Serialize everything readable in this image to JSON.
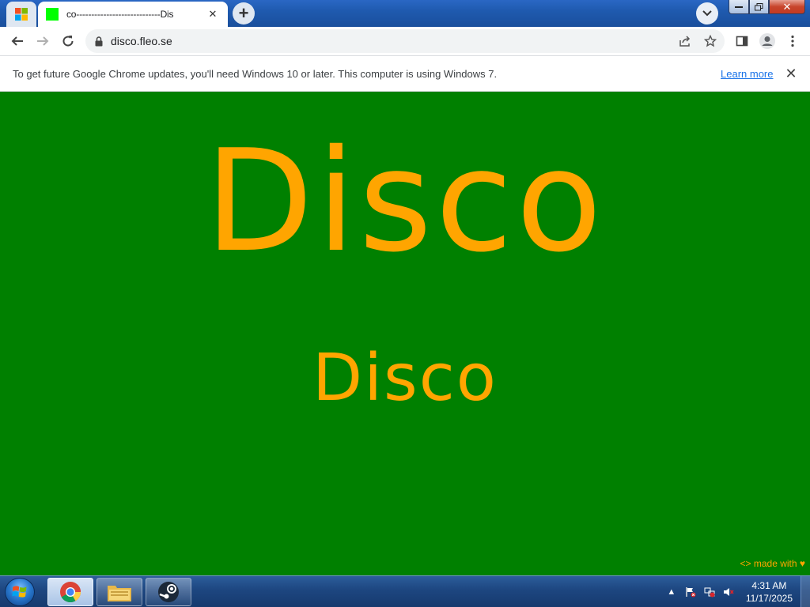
{
  "browser": {
    "tab_title": "co----------------------------Dis",
    "url": "disco.fleo.se",
    "infobar": {
      "message": "To get future Google Chrome updates, you'll need Windows 10 or later. This computer is using Windows 7.",
      "link": "Learn more"
    }
  },
  "page": {
    "heading": "Disco",
    "subheading": "Disco",
    "footer": "<> made with ♥",
    "colors": {
      "background": "#008000",
      "text": "#ffa500"
    }
  },
  "taskbar": {
    "time": "4:31 AM",
    "date": "11/17/2025"
  }
}
